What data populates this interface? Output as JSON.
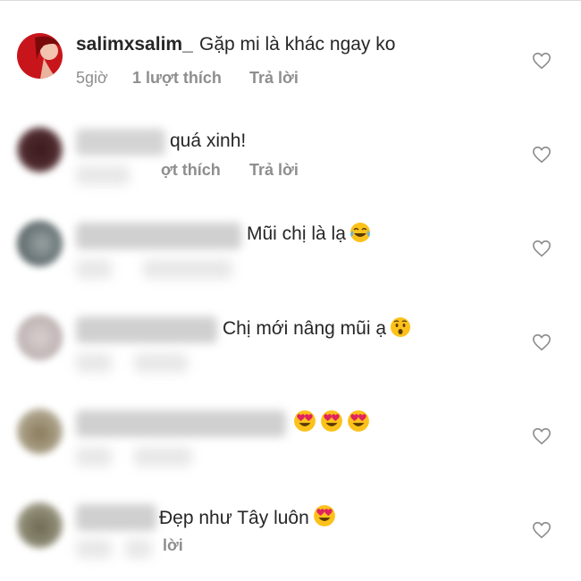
{
  "comments": [
    {
      "username": "salimxsalim_",
      "text": "Gặp mi là khác ngay ko",
      "time": "5giờ",
      "likes": "1 lượt thích",
      "reply": "Trả lời"
    },
    {
      "username": "",
      "text": "quá xinh!",
      "time": "",
      "likes": "ợt thích",
      "reply": "Trả lời"
    },
    {
      "username": "",
      "text": "Mũi chị là lạ",
      "emoji": [
        "face-with-tears-of-joy"
      ],
      "time": "",
      "likes": "",
      "reply": ""
    },
    {
      "username": "",
      "text": "Chị mới nâng mũi ạ",
      "emoji": [
        "hushed-face"
      ],
      "time": "",
      "likes": "",
      "reply": ""
    },
    {
      "username": "",
      "text": "",
      "emoji": [
        "heart-eyes",
        "heart-eyes",
        "heart-eyes"
      ],
      "time": "",
      "likes": "",
      "reply": ""
    },
    {
      "username": "",
      "text": "Đẹp như Tây luôn",
      "emoji": [
        "heart-eyes"
      ],
      "time": "",
      "likes": "",
      "reply": "lời"
    }
  ],
  "colors": {
    "text": "#262626",
    "meta": "#8e8e8e",
    "heart_outline": "#8e8e8e",
    "divider": "#dbdbdb"
  },
  "icons": {
    "like": "heart-outline-icon"
  }
}
